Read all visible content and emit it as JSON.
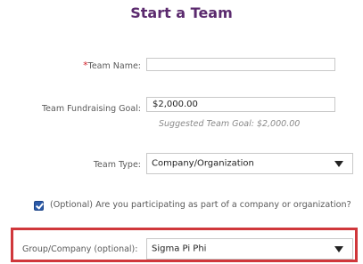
{
  "page": {
    "title": "Start a Team"
  },
  "form": {
    "team_name": {
      "required_mark": "*",
      "label": "Team Name:",
      "value": ""
    },
    "goal": {
      "label": "Team Fundraising Goal:",
      "value": "$2,000.00",
      "hint": "Suggested Team Goal: $2,000.00"
    },
    "team_type": {
      "label": "Team Type:",
      "selected": "Company/Organization"
    },
    "participation": {
      "checked": true,
      "label": "(Optional) Are you participating as part of a company or organization?"
    },
    "group_company": {
      "label": "Group/Company (optional):",
      "selected": "Sigma Pi Phi",
      "highlight_color": "#d0373b"
    }
  },
  "colors": {
    "title": "#5b2a6e",
    "required": "#d0202a",
    "checkbox": "#2b5aa8"
  },
  "icons": {
    "dropdown_arrow": "chevron-down-icon",
    "checkbox": "checkmark-icon"
  }
}
